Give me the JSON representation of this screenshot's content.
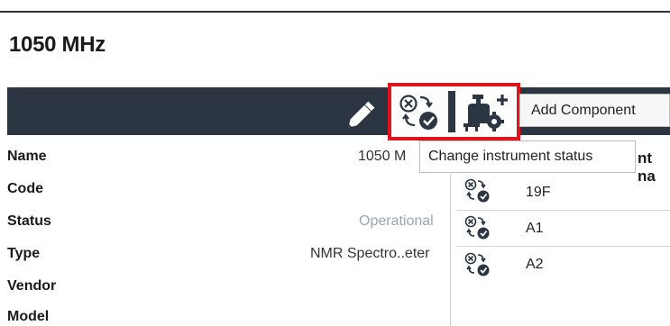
{
  "page": {
    "title": "1050 MHz"
  },
  "toolbar": {
    "edit_icon": "pencil-icon",
    "change_status_icon": "change-status-icon",
    "add_component_icon": "add-component-icon",
    "add_component_label": "Add Component",
    "tooltip": "Change instrument status",
    "highlight_color": "#e0141b",
    "bar_color": "#2b3642"
  },
  "properties": [
    {
      "label": "Name",
      "value": "1050 M"
    },
    {
      "label": "Code",
      "value": ""
    },
    {
      "label": "Status",
      "value": "Operational"
    },
    {
      "label": "Type",
      "value": "NMR Spectro..eter"
    },
    {
      "label": "Vendor",
      "value": ""
    },
    {
      "label": "Model",
      "value": ""
    }
  ],
  "components": {
    "header_fragment": "nt na",
    "rows": [
      {
        "name": "19F",
        "icon": "change-status-icon"
      },
      {
        "name": "A1",
        "icon": "change-status-icon"
      },
      {
        "name": "A2",
        "icon": "change-status-icon"
      }
    ]
  }
}
